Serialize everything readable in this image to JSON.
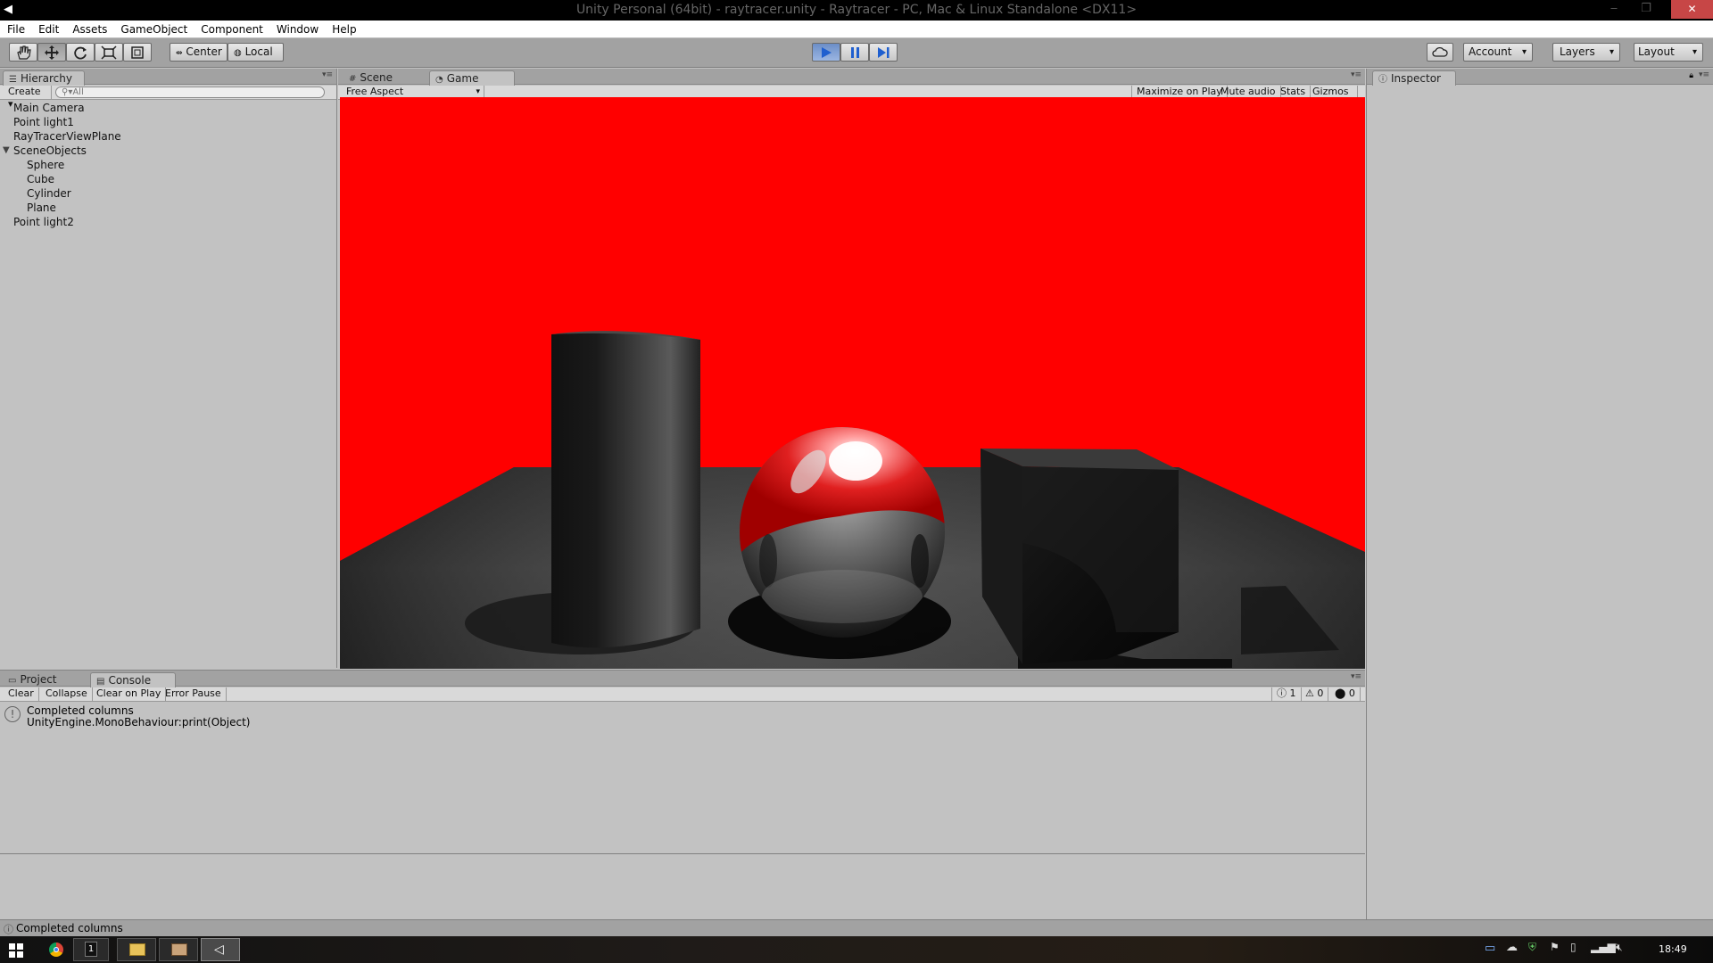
{
  "window": {
    "title": "Unity Personal (64bit) - raytracer.unity - Raytracer - PC, Mac & Linux Standalone <DX11>"
  },
  "menu": [
    "File",
    "Edit",
    "Assets",
    "GameObject",
    "Component",
    "Window",
    "Help"
  ],
  "toolbar": {
    "pivot_label": "Center",
    "space_label": "Local",
    "account_label": "Account",
    "layers_label": "Layers",
    "layout_label": "Layout",
    "play_color": "#5f86c9"
  },
  "hierarchy": {
    "tab": "Hierarchy",
    "create_label": "Create",
    "search_placeholder": "All",
    "items": [
      {
        "label": "Main Camera",
        "depth": 0
      },
      {
        "label": "Point light1",
        "depth": 0
      },
      {
        "label": "RayTracerViewPlane",
        "depth": 0
      },
      {
        "label": "SceneObjects",
        "depth": 0,
        "expanded": true
      },
      {
        "label": "Sphere",
        "depth": 1
      },
      {
        "label": "Cube",
        "depth": 1
      },
      {
        "label": "Cylinder",
        "depth": 1
      },
      {
        "label": "Plane",
        "depth": 1
      },
      {
        "label": "Point light2",
        "depth": 0
      }
    ]
  },
  "center": {
    "tabs": [
      "Scene",
      "Game"
    ],
    "active_tab": "Game",
    "aspect_label": "Free Aspect",
    "options": [
      "Maximize on Play",
      "Mute audio",
      "Stats",
      "Gizmos"
    ],
    "render_background": "#ff0000"
  },
  "inspector": {
    "tab": "Inspector"
  },
  "console": {
    "tabs": [
      "Project",
      "Console"
    ],
    "active_tab": "Console",
    "buttons": [
      "Clear",
      "Collapse",
      "Clear on Play",
      "Error Pause"
    ],
    "counts": {
      "info": "1",
      "warning": "0",
      "error": "0"
    },
    "entries": [
      {
        "line1": "Completed columns",
        "line2": "UnityEngine.MonoBehaviour:print(Object)"
      }
    ]
  },
  "status": {
    "text": "Completed columns"
  },
  "taskbar": {
    "clock": "18:49",
    "badge": "1"
  }
}
